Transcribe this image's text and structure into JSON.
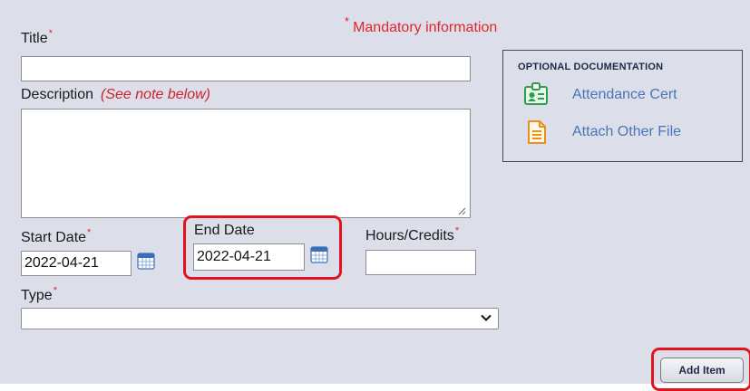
{
  "form": {
    "mandatory_star": "*",
    "mandatory_text": "Mandatory information",
    "title_label": "Title",
    "title_value": "",
    "description_label": "Description",
    "description_note": "(See note below)",
    "description_value": "",
    "start_date_label": "Start Date",
    "start_date_value": "2022-04-21",
    "end_date_label": "End Date",
    "end_date_value": "2022-04-21",
    "hours_label": "Hours/Credits",
    "hours_value": "",
    "type_label": "Type",
    "type_selected": "",
    "required_marker": "*"
  },
  "optional_docs": {
    "heading": "OPTIONAL DOCUMENTATION",
    "links": [
      {
        "label": "Attendance Cert",
        "icon": "id-badge-icon"
      },
      {
        "label": "Attach Other File",
        "icon": "document-icon"
      }
    ]
  },
  "actions": {
    "add_item_label": "Add Item"
  },
  "colors": {
    "panel_bg": "#dcdfea",
    "required_red": "#e0262b",
    "highlight_red": "#e0141c",
    "link_blue": "#4a74b8",
    "cert_icon_green": "#2e9d4a",
    "file_icon_orange": "#e8901a"
  }
}
